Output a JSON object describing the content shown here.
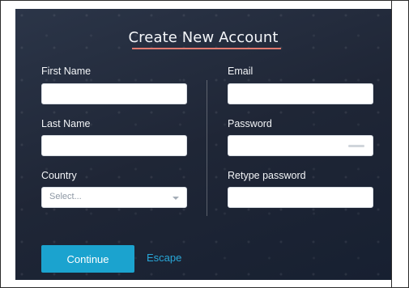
{
  "form": {
    "title": "Create New Account",
    "first_name_label": "First Name",
    "last_name_label": "Last Name",
    "country_label": "Country",
    "email_label": "Email",
    "password_label": "Password",
    "retype_label": "Retype password",
    "country_placeholder": "Select...",
    "continue_label": "Continue",
    "escape_label": "Escape"
  },
  "colors": {
    "accent_underline": "#e07a6f",
    "primary_button": "#1ba3cf",
    "link": "#28a7d8",
    "panel_bg": "#1f2636"
  },
  "icons": {
    "select_chevron": "chevron-down-icon"
  }
}
